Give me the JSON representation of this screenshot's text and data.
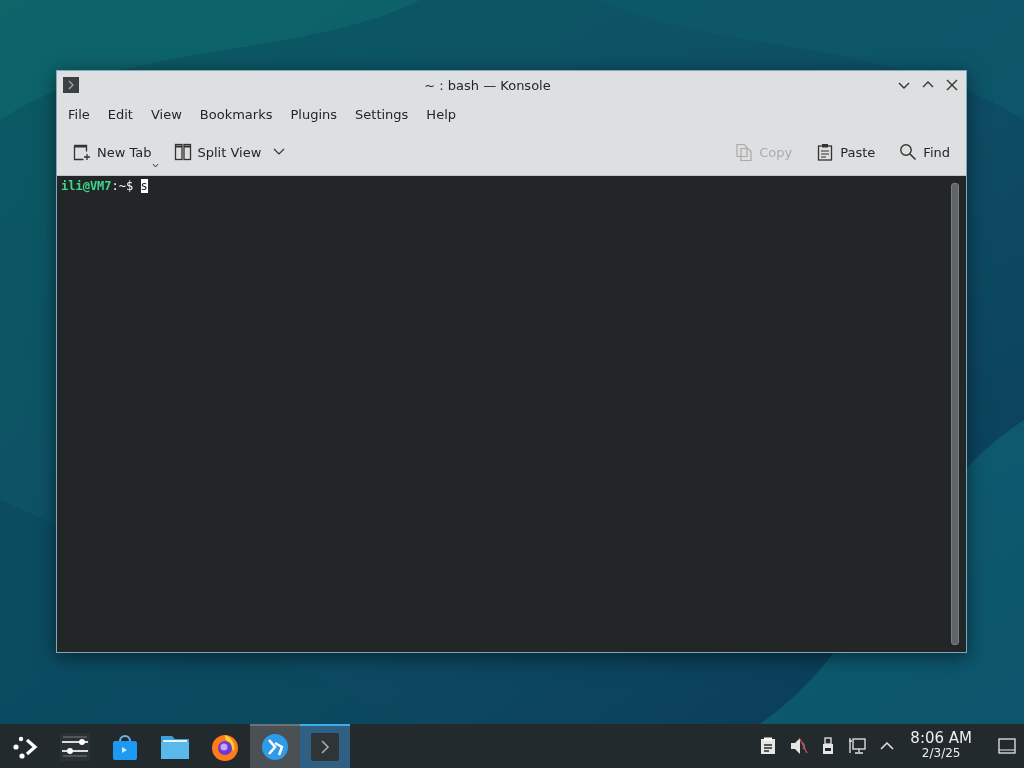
{
  "window": {
    "title": "~ : bash — Konsole",
    "menu": [
      "File",
      "Edit",
      "View",
      "Bookmarks",
      "Plugins",
      "Settings",
      "Help"
    ],
    "toolbar_left": [
      {
        "kind": "new-tab",
        "label": "New Tab",
        "disabled": false,
        "corner_arrow": true,
        "dropdown": false
      },
      {
        "kind": "split",
        "label": "Split View",
        "disabled": false,
        "corner_arrow": false,
        "dropdown": true
      }
    ],
    "toolbar_right": [
      {
        "kind": "copy",
        "label": "Copy",
        "disabled": true
      },
      {
        "kind": "paste",
        "label": "Paste",
        "disabled": false
      },
      {
        "kind": "find",
        "label": "Find",
        "disabled": false
      }
    ],
    "terminal": {
      "user_host": "ili@VM7",
      "separator": ":",
      "path": "~",
      "symbol": "$",
      "input": "s"
    }
  },
  "taskbar": {
    "items": [
      {
        "kind": "launcher",
        "selected": false,
        "hovered": false
      },
      {
        "kind": "settings",
        "selected": false,
        "hovered": false
      },
      {
        "kind": "store",
        "selected": false,
        "hovered": false
      },
      {
        "kind": "folder",
        "selected": false,
        "hovered": false
      },
      {
        "kind": "browser",
        "selected": false,
        "hovered": false
      },
      {
        "kind": "remote",
        "selected": false,
        "hovered": true
      },
      {
        "kind": "terminal",
        "selected": true,
        "hovered": false
      }
    ],
    "tray": [
      {
        "kind": "clipboard"
      },
      {
        "kind": "volume-muted"
      },
      {
        "kind": "usb"
      },
      {
        "kind": "network"
      },
      {
        "kind": "expand"
      }
    ],
    "clock": {
      "time": "8:06 AM",
      "date": "2/3/25"
    }
  }
}
